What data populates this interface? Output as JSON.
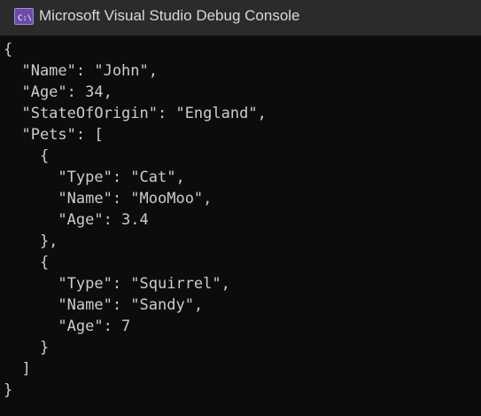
{
  "window": {
    "title": "Microsoft Visual Studio Debug Console",
    "icon": "visual-studio-console-icon",
    "icon_glyph": "C:\\"
  },
  "console": {
    "lines": [
      "{",
      "  \"Name\": \"John\",",
      "  \"Age\": 34,",
      "  \"StateOfOrigin\": \"England\",",
      "  \"Pets\": [",
      "    {",
      "      \"Type\": \"Cat\",",
      "      \"Name\": \"MooMoo\",",
      "      \"Age\": 3.4",
      "    },",
      "    {",
      "      \"Type\": \"Squirrel\",",
      "      \"Name\": \"Sandy\",",
      "      \"Age\": 7",
      "    }",
      "  ]",
      "}"
    ]
  },
  "colors": {
    "titlebar": "#2b2b2b",
    "background": "#0c0c0c",
    "text": "#cccccc",
    "icon_accent": "#6b4aa8"
  }
}
